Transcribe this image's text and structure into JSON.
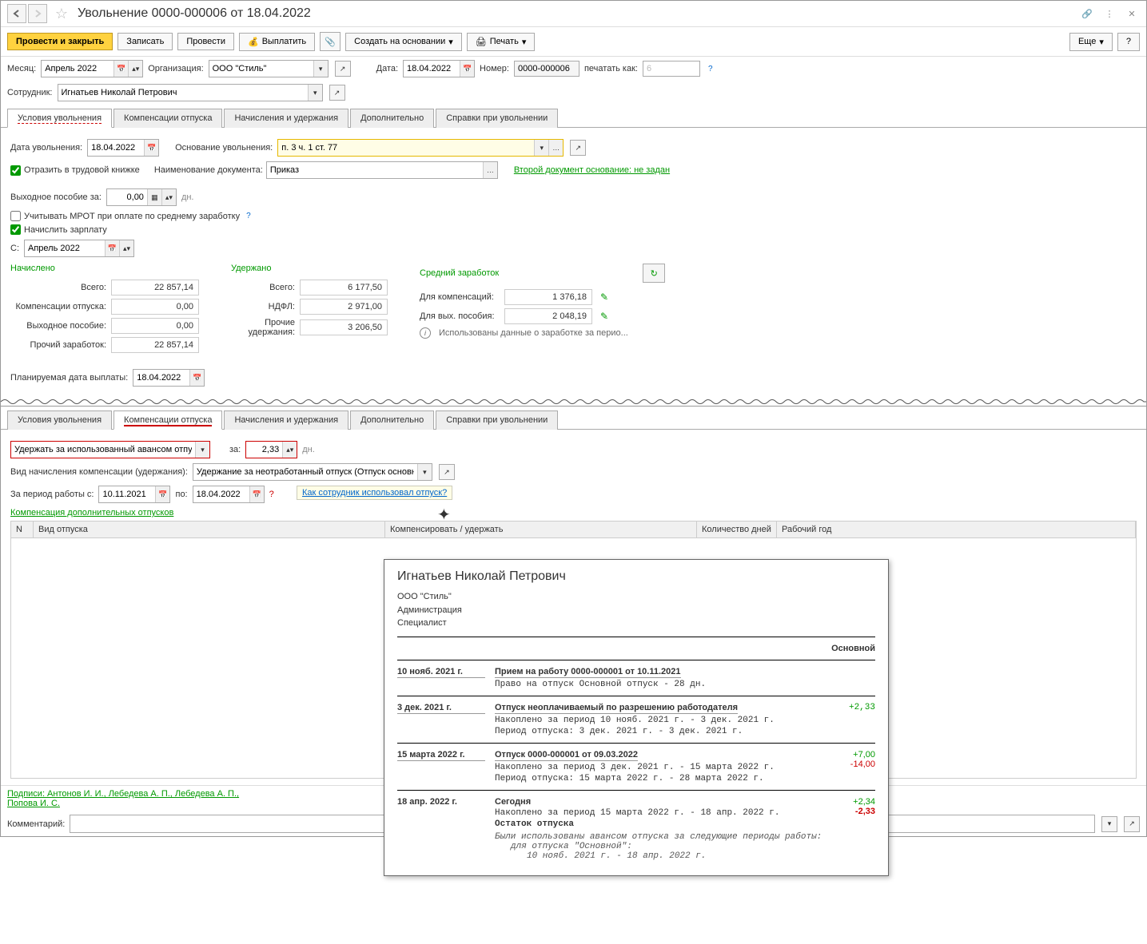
{
  "title": "Увольнение 0000-000006 от 18.04.2022",
  "toolbar": {
    "post_close": "Провести и закрыть",
    "save": "Записать",
    "post": "Провести",
    "pay": "Выплатить",
    "create_based": "Создать на основании",
    "print": "Печать",
    "more": "Еще",
    "help": "?"
  },
  "header": {
    "month_label": "Месяц:",
    "month_value": "Апрель 2022",
    "org_label": "Организация:",
    "org_value": "ООО \"Стиль\"",
    "date_label": "Дата:",
    "date_value": "18.04.2022",
    "number_label": "Номер:",
    "number_value": "0000-000006",
    "print_as_label": "печатать как:",
    "print_as_value": "6",
    "employee_label": "Сотрудник:",
    "employee_value": "Игнатьев Николай Петрович"
  },
  "tabs1": {
    "t0": "Условия увольнения",
    "t1": "Компенсации отпуска",
    "t2": "Начисления и удержания",
    "t3": "Дополнительно",
    "t4": "Справки при увольнении"
  },
  "panel1": {
    "dismiss_date_label": "Дата увольнения:",
    "dismiss_date": "18.04.2022",
    "basis_label": "Основание увольнения:",
    "basis_value": "п. 3 ч. 1 ст. 77",
    "reflect_label": "Отразить в трудовой книжке",
    "doc_name_label": "Наименование документа:",
    "doc_name_value": "Приказ",
    "second_doc": "Второй документ основание: не задан",
    "severance_label": "Выходное пособие за:",
    "severance_value": "0,00",
    "severance_unit": "дн.",
    "mrot_label": "Учитывать МРОТ при оплате по среднему заработку",
    "accrue_label": "Начислить зарплату",
    "s_label": "С:",
    "s_value": "Апрель 2022",
    "accrued_header": "Начислено",
    "withheld_header": "Удержано",
    "avg_header": "Средний заработок",
    "total_label": "Всего:",
    "total_accrued": "22 857,14",
    "total_withheld": "6 177,50",
    "comp_label": "Для компенсаций:",
    "comp_value": "1 376,18",
    "vac_comp_label": "Компенсации отпуска:",
    "vac_comp_value": "0,00",
    "ndfl_label": "НДФЛ:",
    "ndfl_value": "2 971,00",
    "sev_avg_label": "Для вых. пособия:",
    "sev_avg_value": "2 048,19",
    "sev_row_label": "Выходное пособие:",
    "sev_row_value": "0,00",
    "other_with_label": "Прочие удержания:",
    "other_with_value": "3 206,50",
    "info_text": "Использованы данные о заработке за перио...",
    "other_earn_label": "Прочий заработок:",
    "other_earn_value": "22 857,14",
    "plan_date_label": "Планируемая дата выплаты:",
    "plan_date_value": "18.04.2022"
  },
  "tabs2": {
    "t0": "Условия увольнения",
    "t1": "Компенсации отпуска",
    "t2": "Начисления и удержания",
    "t3": "Дополнительно",
    "t4": "Справки при увольнении"
  },
  "panel2": {
    "action_value": "Удержать за использованный авансом отпуск",
    "for_label": "за:",
    "for_value": "2,33",
    "for_unit": "дн.",
    "accrual_type_label": "Вид начисления компенсации (удержания):",
    "accrual_type_value": "Удержание за неотработанный отпуск (Отпуск основной)",
    "period_from_label": "За период работы с:",
    "period_from": "10.11.2021",
    "period_to_label": "по:",
    "period_to": "18.04.2022",
    "extra_comp_label": "Компенсация дополнительных отпусков",
    "how_used_link": "Как сотрудник использовал отпуск?",
    "col_n": "N",
    "col_type": "Вид отпуска",
    "col_comp": "Компенсировать / удержать",
    "col_days": "Количество дней",
    "col_year": "Рабочий год"
  },
  "popup": {
    "name": "Игнатьев Николай Петрович",
    "org": "ООО \"Стиль\"",
    "dept": "Администрация",
    "pos": "Специалист",
    "section": "Основной",
    "ev1_date": "10 нояб. 2021 г.",
    "ev1_title": "Прием на работу 0000-000001 от 10.11.2021",
    "ev1_detail": "Право на отпуск Основной отпуск - 28 дн.",
    "ev2_date": "3 дек. 2021 г.",
    "ev2_title": "Отпуск неоплачиваемый по разрешению работодателя",
    "ev2_d1": "Накоплено за период 10 нояб. 2021 г. - 3 дек. 2021 г.",
    "ev2_d2": "Период отпуска: 3 дек. 2021 г. - 3 дек. 2021 г.",
    "ev2_num": "+2,33",
    "ev3_date": "15 марта 2022 г.",
    "ev3_title": "Отпуск 0000-000001 от 09.03.2022",
    "ev3_d1": "Накоплено за период 3 дек. 2021 г. - 15 марта 2022 г.",
    "ev3_d2": "Период отпуска: 15 марта 2022 г. - 28 марта 2022 г.",
    "ev3_num1": "+7,00",
    "ev3_num2": "-14,00",
    "ev4_date": "18 апр. 2022 г.",
    "ev4_title": "Сегодня",
    "ev4_d1": "Накоплено за период 15 марта 2022 г. - 18 апр. 2022 г.",
    "ev4_d2": "Остаток отпуска",
    "ev4_num1": "+2,34",
    "ev4_num2": "-2,33",
    "ev4_note1": "Были использованы авансом отпуска за следующие периоды работы:",
    "ev4_note2": "для отпуска \"Основной\":",
    "ev4_note3": "10 нояб. 2021 г. - 18 апр. 2022 г."
  },
  "footer": {
    "sign1": "Подписи: Антонов И. И., Лебедева А. П., Лебедева А. П.,",
    "sign2": "Попова И. С.",
    "comment_label": "Комментарий:"
  }
}
